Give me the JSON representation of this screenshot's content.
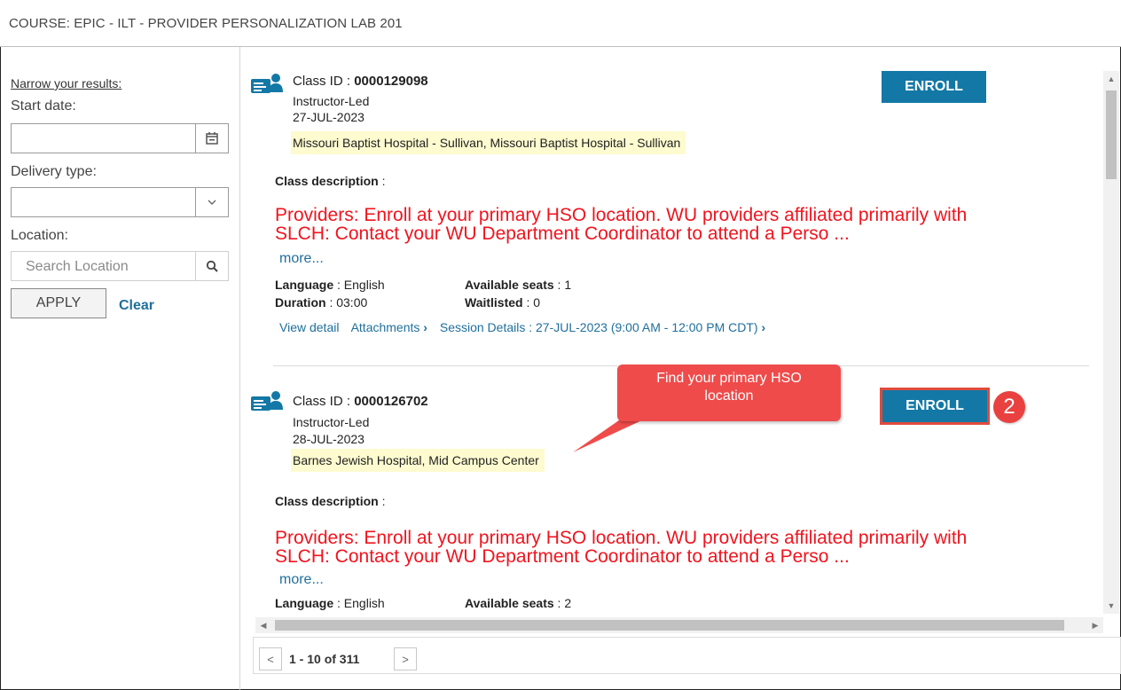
{
  "header": {
    "title": "COURSE: EPIC - ILT - PROVIDER PERSONALIZATION LAB 201"
  },
  "filters": {
    "narrow_label": "Narrow your results:",
    "start_date_label": "Start date:",
    "start_date_value": "",
    "delivery_type_label": "Delivery type:",
    "delivery_type_value": "",
    "location_label": "Location:",
    "location_placeholder": "Search Location",
    "apply_label": "APPLY",
    "clear_label": "Clear"
  },
  "classes": [
    {
      "id_label": "Class ID",
      "id_value": "0000129098",
      "delivery": "Instructor-Led",
      "date": "27-JUL-2023",
      "location": "Missouri Baptist Hospital - Sullivan, Missouri Baptist Hospital - Sullivan",
      "enroll_label": "ENROLL",
      "desc_label": "Class description",
      "desc_line1": "Providers: Enroll at your primary HSO location. WU providers affiliated primarily with",
      "desc_line2": "SLCH: Contact your WU Department Coordinator to attend a Perso ...",
      "more_label": "more...",
      "language_label": "Language",
      "language_value": "English",
      "duration_label": "Duration",
      "duration_value": "03:00",
      "seats_label": "Available seats",
      "seats_value": "1",
      "waitlisted_label": "Waitlisted",
      "waitlisted_value": "0",
      "view_detail": "View detail",
      "attachments": "Attachments",
      "session_details": "Session Details : 27-JUL-2023 (9:00 AM - 12:00 PM CDT)"
    },
    {
      "id_label": "Class ID",
      "id_value": "0000126702",
      "delivery": "Instructor-Led",
      "date": "28-JUL-2023",
      "location": "Barnes Jewish Hospital, Mid Campus Center",
      "enroll_label": "ENROLL",
      "desc_label": "Class description",
      "desc_line1": "Providers: Enroll at your primary HSO location. WU providers affiliated primarily with",
      "desc_line2": "SLCH: Contact your WU Department Coordinator to attend a Perso ...",
      "more_label": "more...",
      "language_label": "Language",
      "language_value": "English",
      "seats_label": "Available seats",
      "seats_value": "2"
    }
  ],
  "annotation": {
    "callout_text": "Find your primary HSO location",
    "step_number": "2",
    "color": "#ef4b4b"
  },
  "pagination": {
    "range_text": "1 - 10 of 311"
  },
  "colors": {
    "accent": "#1378a6",
    "description_red": "#f0141e",
    "highlight": "#fdfbcf"
  }
}
